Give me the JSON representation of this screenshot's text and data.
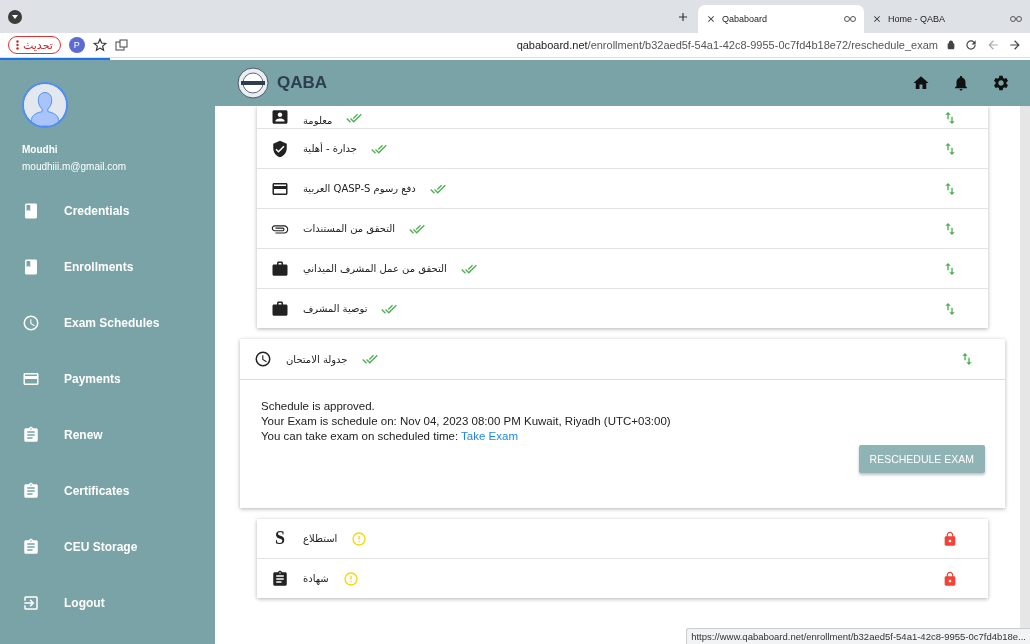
{
  "browser": {
    "tabs": [
      {
        "title": "Home - QABA",
        "selected": false
      },
      {
        "title": "Qababoard",
        "selected": true
      }
    ],
    "update_button": "تحديث",
    "profile_initial": "P",
    "url_host": "qababoard.net",
    "url_path": "/enrollment/b32aed5f-54a1-42c8-9955-0c7fd4b18e72/reschedule_exam",
    "status_url": "https://www.qababoard.net/enrollment/b32aed5f-54a1-42c8-9955-0c7fd4b18e..."
  },
  "sidebar": {
    "user_name": "Moudhi",
    "email": "moudhiii.m@gmail.com",
    "items": [
      {
        "label": "Credentials",
        "kind": "book"
      },
      {
        "label": "Enrollments",
        "kind": "book"
      },
      {
        "label": "Exam Schedules",
        "kind": "clock"
      },
      {
        "label": "Payments",
        "kind": "card"
      },
      {
        "label": "Renew",
        "kind": "clipboard"
      },
      {
        "label": "Certificates",
        "kind": "clipboard"
      },
      {
        "label": "CEU Storage",
        "kind": "clipboard"
      },
      {
        "label": "Logout",
        "kind": "exit"
      }
    ]
  },
  "header": {
    "title": "QABA"
  },
  "steps": [
    {
      "label": "معلومة",
      "kind": "person",
      "completed": true
    },
    {
      "label": "جدارة - أهلية",
      "kind": "shield",
      "completed": true
    },
    {
      "label": "دفع رسوم QASP-S العربية",
      "kind": "card",
      "completed": true
    },
    {
      "label": "التحقق من المستندات",
      "kind": "clip",
      "completed": true
    },
    {
      "label": "التحقق من عمل المشرف الميداني",
      "kind": "briefcase",
      "completed": true
    },
    {
      "label": "توصية المشرف",
      "kind": "briefcase",
      "completed": true
    }
  ],
  "exam_step": {
    "label": "جدولة الامتحان",
    "kind": "clock",
    "completed": true,
    "expanded": true,
    "lines": [
      "Schedule is approved.",
      "Your Exam is schedule on: Nov 04, 2023 08:00 PM Kuwait, Riyadh (UTC+03:00)"
    ],
    "take_text": "You can take exam on scheduled time:",
    "take_link": "Take Exam",
    "button": "RESCHEDULE EXAM"
  },
  "later_steps": [
    {
      "label": "استطلاع",
      "kind": "letter",
      "glyph": "S",
      "completed": false
    },
    {
      "label": "شهادة",
      "kind": "clipboard",
      "completed": false
    }
  ]
}
